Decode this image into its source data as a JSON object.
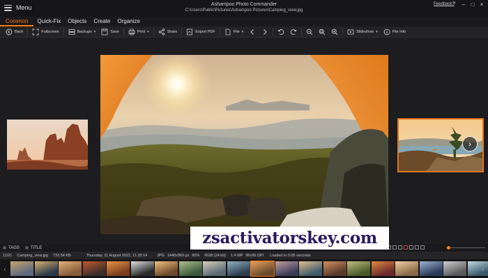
{
  "titlebar": {
    "menu_label": "Menu",
    "app_name": "Ashampoo Photo Commander",
    "file_path": "C:\\Users\\Public\\Pictures\\Ashampoo Pictures\\Camping_view.jpg",
    "feedback_label": "Feedback?",
    "help_label": "?"
  },
  "tabs": [
    {
      "label": "Common",
      "active": true
    },
    {
      "label": "Quick-Fix"
    },
    {
      "label": "Objects"
    },
    {
      "label": "Create"
    },
    {
      "label": "Organize"
    }
  ],
  "toolbar": {
    "back": "Back",
    "fullscreen": "Fullscreen",
    "backups": "Backups",
    "save": "Save",
    "print": "Print",
    "share": "Share",
    "export_pdf": "Export PDF",
    "file": "File",
    "slideshow": "Slideshow",
    "file_info": "File Info"
  },
  "tagbar": {
    "tags_label": "TAGS",
    "title_label": "TITLE"
  },
  "status": {
    "index": "11/21",
    "filename": "Camping_view.jpg",
    "filesize": "732.54 KB",
    "date": "Thursday, 11 August 2022, 11:28:14",
    "format": "JPG",
    "dimensions": "1440x960 px",
    "zoom": "60%",
    "color": "RGB (24 bit)",
    "megapixels": "1.4 MP",
    "dpi": "96x96 DPI",
    "load_time": "Loaded in 0.05 seconds"
  },
  "watermark": "zsactivatorskey.com",
  "colors": {
    "accent": "#f07a1a",
    "background": "#1d1d1f",
    "toolbar": "#232325"
  },
  "next_arrow": "›",
  "filmstrip": {
    "prev": "‹",
    "next": "›",
    "current_index": 11
  }
}
